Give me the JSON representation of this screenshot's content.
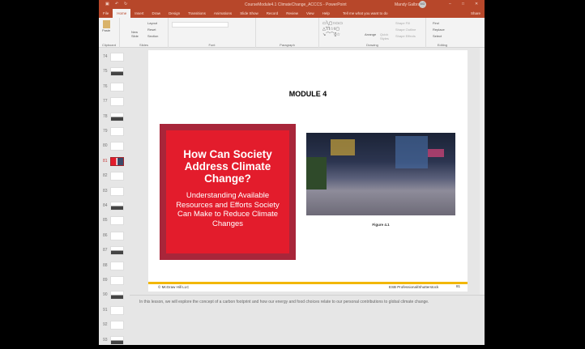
{
  "window": {
    "title": "CourseModule4.1 ClimateChange_ACCCS - PowerPoint",
    "user": "Mandy Galbraith",
    "user_initials": "MG"
  },
  "tabs": [
    "File",
    "Home",
    "Insert",
    "Draw",
    "Design",
    "Transitions",
    "Animations",
    "Slide Show",
    "Record",
    "Review",
    "View",
    "Help"
  ],
  "tell_me": "Tell me what you want to do",
  "share": "Share",
  "ribbon": {
    "clipboard": {
      "label": "Clipboard",
      "paste": "Paste"
    },
    "slides": {
      "label": "Slides",
      "new_slide": "New Slide",
      "layout": "Layout",
      "reset": "Reset",
      "section": "Section"
    },
    "font": {
      "label": "Font"
    },
    "paragraph": {
      "label": "Paragraph"
    },
    "drawing": {
      "label": "Drawing",
      "arrange": "Arrange",
      "quick_styles": "Quick Styles",
      "shape_fill": "Shape Fill",
      "shape_outline": "Shape Outline",
      "shape_effects": "Shape Effects"
    },
    "editing": {
      "label": "Editing",
      "find": "Find",
      "replace": "Replace",
      "select": "Select"
    }
  },
  "thumbnails": [
    74,
    75,
    76,
    77,
    78,
    79,
    80,
    81,
    82,
    83,
    84,
    85,
    86,
    87,
    88,
    89,
    90,
    91,
    92,
    93
  ],
  "selected_slide": 81,
  "slide": {
    "heading": "MODULE 4",
    "title": "How Can Society Address Climate Change?",
    "subtitle": "Understanding Available Resources and Efforts Society Can Make to Reduce Climate Changes",
    "figure_caption": "Figure 4.1",
    "footer_left": "© McGraw Hill LLC",
    "footer_credit": "ESB Professional/Shutterstock",
    "page_number": "81"
  },
  "notes": "In this lesson, we will explore the concept of a carbon footprint and how our energy and food choices relate to our personal contributions to global climate change.",
  "colors": {
    "accent": "#b7472a",
    "red_box": "#e31c2c",
    "red_border": "#a8263a",
    "footer_line": "#f2b700"
  }
}
